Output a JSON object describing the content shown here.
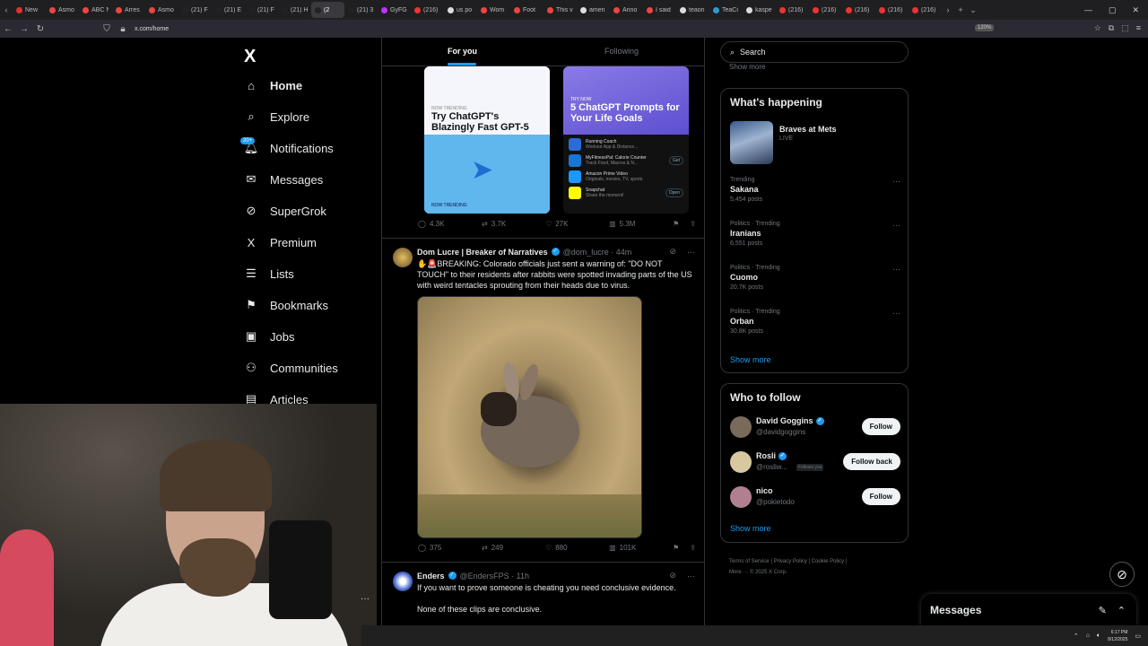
{
  "browser": {
    "tabs": [
      {
        "title": "New",
        "color": "#d33"
      },
      {
        "title": "Asmo",
        "color": "#e44"
      },
      {
        "title": "ABC N",
        "color": "#e44"
      },
      {
        "title": "Arres",
        "color": "#e44"
      },
      {
        "title": "Asmo",
        "color": "#e44"
      },
      {
        "title": "(21) F",
        "color": "#222"
      },
      {
        "title": "(21) E",
        "color": "#222"
      },
      {
        "title": "(21) F",
        "color": "#222"
      },
      {
        "title": "(21) H",
        "color": "#222"
      },
      {
        "title": "(2",
        "color": "#222",
        "active": true
      },
      {
        "title": "(21) 3",
        "color": "#222"
      },
      {
        "title": "GyFG",
        "color": "#b3f"
      },
      {
        "title": "(216)",
        "color": "#e33"
      },
      {
        "title": "us po",
        "color": "#ddd"
      },
      {
        "title": "Wom",
        "color": "#e44"
      },
      {
        "title": "Foot",
        "color": "#e44"
      },
      {
        "title": "This v",
        "color": "#e44"
      },
      {
        "title": "amen",
        "color": "#ddd"
      },
      {
        "title": "Anno",
        "color": "#e44"
      },
      {
        "title": "I said",
        "color": "#e44"
      },
      {
        "title": "teaon",
        "color": "#ddd"
      },
      {
        "title": "TeaCi",
        "color": "#39c"
      },
      {
        "title": "kaspe",
        "color": "#ddd"
      },
      {
        "title": "(216)",
        "color": "#e33"
      },
      {
        "title": "(216)",
        "color": "#e33"
      },
      {
        "title": "(216)",
        "color": "#e33"
      },
      {
        "title": "(216)",
        "color": "#e33"
      },
      {
        "title": "(216)",
        "color": "#e33"
      }
    ],
    "url": "x.com/home",
    "zoom": "120%"
  },
  "sidebar": {
    "logo": "X",
    "notif_badge": "20+",
    "items": [
      {
        "label": "Home",
        "icon": "⌂",
        "name": "home"
      },
      {
        "label": "Explore",
        "icon": "⌕",
        "name": "explore"
      },
      {
        "label": "Notifications",
        "icon": "🔔︎",
        "name": "notifications"
      },
      {
        "label": "Messages",
        "icon": "✉",
        "name": "messages"
      },
      {
        "label": "SuperGrok",
        "icon": "⊘",
        "name": "supergrok"
      },
      {
        "label": "Premium",
        "icon": "X",
        "name": "premium"
      },
      {
        "label": "Lists",
        "icon": "☰",
        "name": "lists"
      },
      {
        "label": "Bookmarks",
        "icon": "⚑",
        "name": "bookmarks"
      },
      {
        "label": "Jobs",
        "icon": "▣",
        "name": "jobs"
      },
      {
        "label": "Communities",
        "icon": "⚇",
        "name": "communities"
      },
      {
        "label": "Articles",
        "icon": "▤",
        "name": "articles"
      }
    ]
  },
  "feed": {
    "tab_for_you": "For you",
    "tab_following": "Following",
    "card1": {
      "kicker": "NOW TRENDING",
      "title": "Try ChatGPT's Blazingly Fast GPT-5",
      "kicker2": "NOW TRENDING"
    },
    "card2": {
      "kicker": "TRY NOW",
      "title": "5 ChatGPT Prompts for Your Life Goals",
      "apps": [
        {
          "name": "Running Coach",
          "sub": "Workout App & Distance...",
          "color": "#2a6bd6",
          "btn": ""
        },
        {
          "name": "MyFitnessPal: Calorie Counter",
          "sub": "Track Food, Macros & N...",
          "color": "#1976d2",
          "btn": "Get"
        },
        {
          "name": "Amazon Prime Video",
          "sub": "Originals, movies, TV, sports",
          "color": "#1a98ff",
          "btn": ""
        },
        {
          "name": "Snapchat",
          "sub": "Share the moment!",
          "color": "#fffc00",
          "btn": "Open"
        }
      ]
    },
    "first_actions": {
      "replies": "4.3K",
      "reposts": "3.7K",
      "likes": "27K",
      "views": "5.3M"
    },
    "post1": {
      "name": "Dom Lucre | Breaker of Narratives",
      "handle": "@dom_lucre · 44m",
      "text": "✋🚨BREAKING: Colorado officials just sent a warning of: \"DO NOT TOUCH\" to their residents after rabbits were spotted invading parts of the US with weird tentacles sprouting from their heads due to virus.",
      "replies": "375",
      "reposts": "249",
      "likes": "880",
      "views": "101K"
    },
    "post2": {
      "name": "Enders",
      "handle": "@EndersFPS · 11h",
      "text1": "If you want to prove someone is cheating you need conclusive evidence.",
      "text2": "None of these clips are conclusive."
    }
  },
  "right": {
    "search_placeholder": "Search",
    "cut_text": "Show more",
    "happening_title": "What's happening",
    "event": {
      "name": "Braves at Mets",
      "status": "LIVE"
    },
    "trends": [
      {
        "context": "Trending",
        "name": "Sakana",
        "count": "5,454 posts"
      },
      {
        "context": "Politics · Trending",
        "name": "Iranians",
        "count": "6,551 posts"
      },
      {
        "context": "Politics · Trending",
        "name": "Cuomo",
        "count": "20.7K posts"
      },
      {
        "context": "Politics · Trending",
        "name": "Orban",
        "count": "30.8K posts"
      }
    ],
    "show_more": "Show more",
    "who_title": "Who to follow",
    "who": [
      {
        "name": "David Goggins",
        "handle": "@davidgoggins",
        "btn": "Follow",
        "follows_you": "",
        "color": "#7a6a5a"
      },
      {
        "name": "Rosli",
        "handle": "@rosliw...",
        "btn": "Follow back",
        "follows_you": "Follows you",
        "color": "#d8c8a0"
      },
      {
        "name": "nico",
        "handle": "@pokietodo",
        "btn": "Follow",
        "follows_you": "",
        "color": "#b08090"
      }
    ],
    "who_show_more": "Show more",
    "footer1": "Terms of Service  |  Privacy Policy  |  Cookie Policy  |",
    "footer2": "More ···  © 2025 X Corp."
  },
  "messages_dock": {
    "title": "Messages"
  },
  "taskbar": {
    "time": "6:17 PM",
    "date": "8/12/2025"
  }
}
